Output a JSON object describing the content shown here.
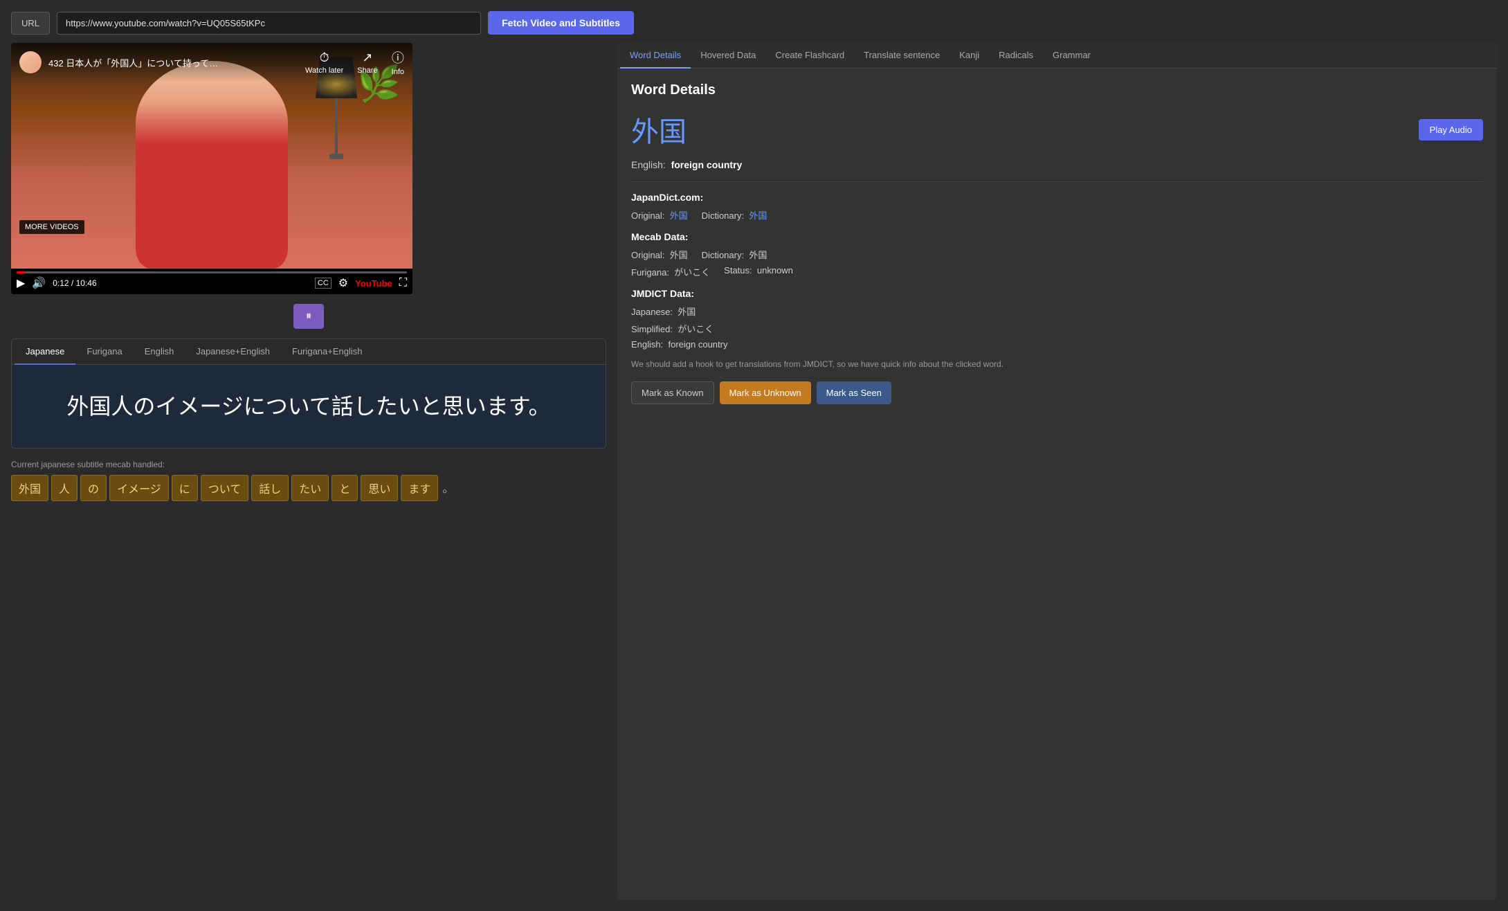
{
  "url_bar": {
    "label": "URL",
    "input_value": "https://www.youtube.com/watch?v=UQ05S65tKPc",
    "fetch_button": "Fetch Video and Subtitles"
  },
  "video": {
    "title": "432 日本人が「外国人」について持って…",
    "time_current": "0:12",
    "time_total": "10:46",
    "more_videos": "MORE VIDEOS",
    "overlay_actions": [
      {
        "icon": "⏱",
        "label": "Watch later"
      },
      {
        "icon": "↗",
        "label": "Share"
      },
      {
        "icon": "ⓘ",
        "label": "Info"
      }
    ]
  },
  "subtitle_tabs": [
    {
      "id": "japanese",
      "label": "Japanese",
      "active": true
    },
    {
      "id": "furigana",
      "label": "Furigana",
      "active": false
    },
    {
      "id": "english",
      "label": "English",
      "active": false
    },
    {
      "id": "japanese_english",
      "label": "Japanese+English",
      "active": false
    },
    {
      "id": "furigana_english",
      "label": "Furigana+English",
      "active": false
    }
  ],
  "subtitle_text": "外国人のイメージについて話したいと思います。",
  "mecab_label": "Current japanese subtitle mecab handled:",
  "mecab_tokens": [
    {
      "text": "外国",
      "type": "token"
    },
    {
      "text": "人",
      "type": "token"
    },
    {
      "text": "の",
      "type": "token"
    },
    {
      "text": "イメージ",
      "type": "token"
    },
    {
      "text": "に",
      "type": "token"
    },
    {
      "text": "ついて",
      "type": "token"
    },
    {
      "text": "話し",
      "type": "token"
    },
    {
      "text": "たい",
      "type": "token"
    },
    {
      "text": "と",
      "type": "token"
    },
    {
      "text": "思い",
      "type": "token"
    },
    {
      "text": "ます",
      "type": "token"
    },
    {
      "text": "。",
      "type": "punct"
    }
  ],
  "word_details": {
    "title": "Word Details",
    "kanji": "外国",
    "play_audio_label": "Play Audio",
    "english_label": "English:",
    "english_value": "foreign country",
    "japan_dict_header": "JapanDict.com:",
    "original_label": "Original:",
    "original_value": "外国",
    "original_link": "外国",
    "dictionary_label": "Dictionary:",
    "dictionary_value": "外国",
    "dictionary_link": "外国",
    "mecab_header": "Mecab Data:",
    "mecab_original_label": "Original:",
    "mecab_original_value": "外国",
    "mecab_dictionary_label": "Dictionary:",
    "mecab_dictionary_value": "外国",
    "mecab_furigana_label": "Furigana:",
    "mecab_furigana_value": "がいこく",
    "mecab_status_label": "Status:",
    "mecab_status_value": "unknown",
    "jmdict_header": "JMDICT Data:",
    "jmdict_japanese_label": "Japanese:",
    "jmdict_japanese_value": "外国",
    "jmdict_simplified_label": "Simplified:",
    "jmdict_simplified_value": "がいこく",
    "jmdict_english_label": "English:",
    "jmdict_english_value": "foreign country",
    "note": "We should add a hook to get translations from JMDICT, so we have quick info about the clicked word.",
    "btn_mark_known": "Mark as Known",
    "btn_mark_unknown": "Mark as Unknown",
    "btn_mark_seen": "Mark as Seen"
  },
  "right_tabs": [
    {
      "id": "word_details",
      "label": "Word Details",
      "active": true
    },
    {
      "id": "hovered_data",
      "label": "Hovered Data",
      "active": false
    },
    {
      "id": "create_flashcard",
      "label": "Create Flashcard",
      "active": false
    },
    {
      "id": "translate_sentence",
      "label": "Translate sentence",
      "active": false
    },
    {
      "id": "kanji",
      "label": "Kanji",
      "active": false
    },
    {
      "id": "radicals",
      "label": "Radicals",
      "active": false
    },
    {
      "id": "grammar",
      "label": "Grammar",
      "active": false
    }
  ]
}
